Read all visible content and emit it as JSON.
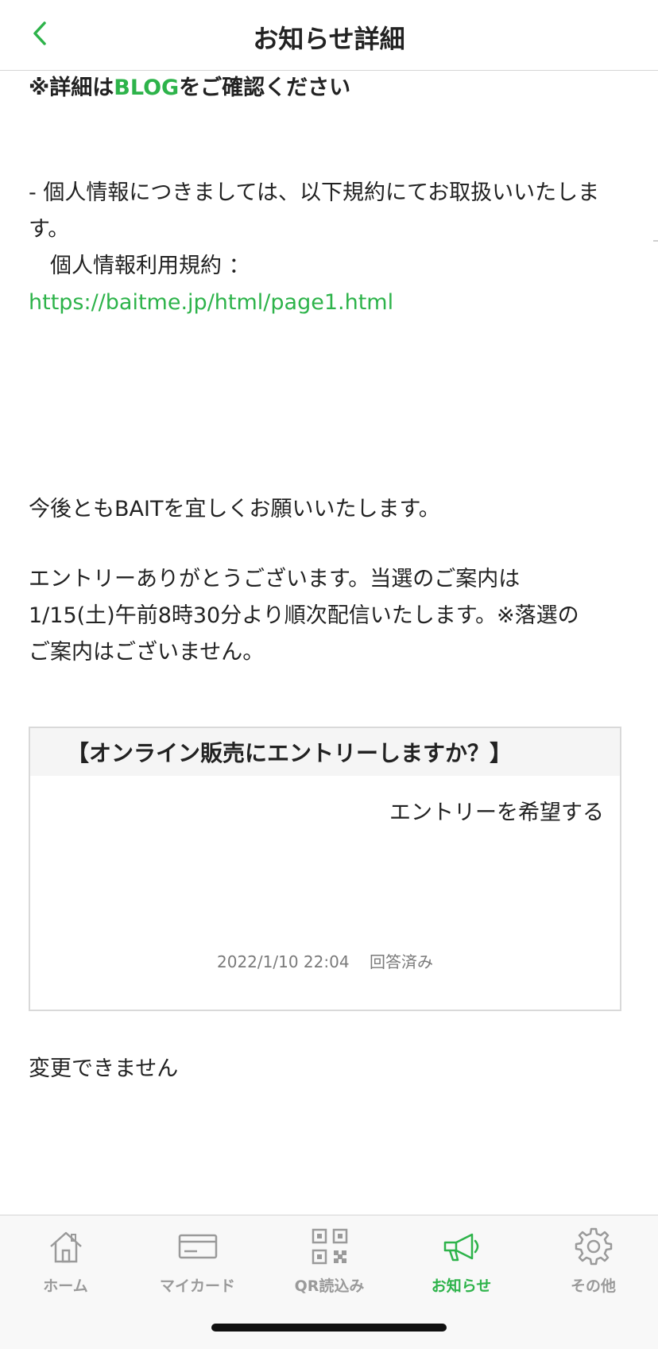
{
  "header": {
    "title": "お知らせ詳細"
  },
  "body": {
    "blog_prefix": "※詳細は",
    "blog_link": "BLOG",
    "blog_suffix": "をご確認ください",
    "privacy_line1": "- 個人情報につきましては、以下規約にてお取扱いいたしま",
    "privacy_line2": "す。",
    "terms_label": "　個人情報利用規約 ：",
    "terms_url": "https://baitme.jp/html/page1.html",
    "closing": "今後ともBAITを宜しくお願いいたします。",
    "entry_line1": "エントリーありがとうございます。当選のご案内は",
    "entry_line2": "1/15(土)午前8時30分より順次配信いたします。※落選の",
    "entry_line3": "ご案内はございません。"
  },
  "question_card": {
    "title": "【オンライン販売にエントリーしますか？】",
    "answer": "エントリーを希望する",
    "timestamp": "2022/1/10 22:04",
    "status": "回答済み"
  },
  "note": "変更できません",
  "tabbar": {
    "accent_color": "#2db34a",
    "inactive_color": "#9a9a9a",
    "items": [
      {
        "label": "ホーム",
        "icon": "home-icon"
      },
      {
        "label": "マイカード",
        "icon": "card-icon"
      },
      {
        "label": "QR読込み",
        "icon": "qr-code-icon"
      },
      {
        "label": "お知らせ",
        "icon": "megaphone-icon",
        "active": true
      },
      {
        "label": "その他",
        "icon": "gear-icon"
      }
    ]
  }
}
